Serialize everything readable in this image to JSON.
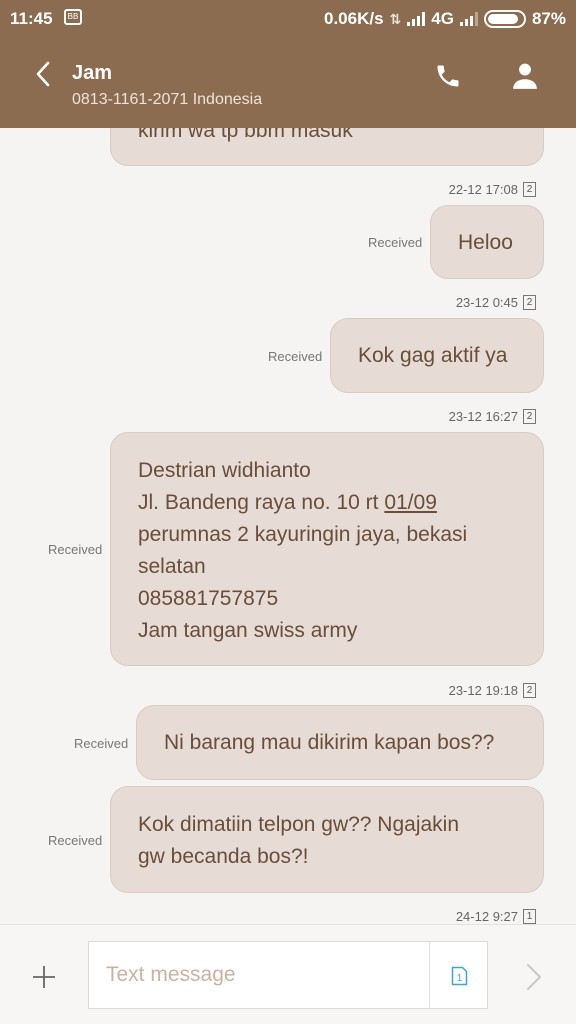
{
  "status_bar": {
    "time": "11:45",
    "speed": "0.06K/s",
    "network": "4G",
    "battery": "87%",
    "battery_level": 0.87
  },
  "app_bar": {
    "name": "Jam",
    "number": "0813-1161-2071 Indonesia"
  },
  "thread": {
    "partial_message": "kirim wa tp bbm masuk",
    "messages": [
      {
        "time": "22-12 17:08",
        "sim": "2",
        "status": "Received",
        "lines": [
          "Heloo"
        ]
      },
      {
        "time": "23-12 0:45",
        "sim": "2",
        "status": "Received",
        "lines": [
          "Kok gag aktif ya"
        ]
      },
      {
        "time": "23-12 16:27",
        "sim": "2",
        "status": "Received",
        "lines": [
          "Destrian widhianto",
          "Jl. Bandeng raya no. 10 rt ",
          "01/09",
          "perumnas 2 kayuringin jaya,  bekasi",
          "selatan",
          "085881757875",
          "Jam tangan swiss army"
        ]
      },
      {
        "time": "23-12 19:18",
        "sim": "2",
        "status": "Received",
        "lines": [
          "Ni barang mau dikirim kapan bos??"
        ]
      },
      {
        "time": "",
        "sim": "",
        "status": "Received",
        "lines": [
          "Kok dimatiin telpon gw??  Ngajakin",
          "gw  becanda bos?!"
        ]
      },
      {
        "time": "24-12 9:27",
        "sim": "1",
        "status": "",
        "lines": []
      }
    ]
  },
  "composer": {
    "placeholder": "Text message",
    "sim_badge": "1"
  },
  "colors": {
    "header": "#8b6c51",
    "bubble": "#e6dcd5",
    "bubble_text": "#6a4d3a",
    "placeholder": "#c7b3a2",
    "sim_accent": "#3aa7d6"
  },
  "icons": [
    "back-icon",
    "call-icon",
    "person-icon",
    "plus-icon",
    "sim-icon",
    "send-icon",
    "bbm-icon",
    "signal-icon",
    "battery-icon"
  ]
}
